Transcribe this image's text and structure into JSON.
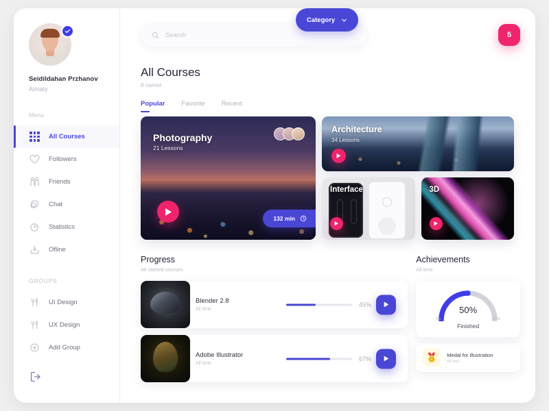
{
  "profile": {
    "name": "Seidildahan Przhanov",
    "city": "Almaty",
    "verified_icon": "check-icon"
  },
  "sidebar": {
    "menu_label": "Menu",
    "groups_label": "GROUPS",
    "menu_items": [
      {
        "label": "All Courses",
        "icon": "grid-icon",
        "active": true
      },
      {
        "label": "Followers",
        "icon": "heart-icon",
        "active": false
      },
      {
        "label": "Friends",
        "icon": "friends-icon",
        "active": false
      },
      {
        "label": "Chat",
        "icon": "chat-icon",
        "active": false
      },
      {
        "label": "Statistics",
        "icon": "pie-chart-icon",
        "active": false
      },
      {
        "label": "Ofline",
        "icon": "download-icon",
        "active": false
      }
    ],
    "groups": [
      {
        "label": "UI Design",
        "icon": "tools-icon"
      },
      {
        "label": "UX Design",
        "icon": "tools-icon"
      },
      {
        "label": "Add Group",
        "icon": "plus-circle-icon"
      }
    ],
    "logout_icon": "logout-icon"
  },
  "topbar": {
    "search_placeholder": "Search",
    "search_value": "",
    "search_icon": "search-icon",
    "category_label": "Category",
    "category_caret_icon": "chevron-down-icon",
    "notification_count": "5"
  },
  "page": {
    "title": "All Courses",
    "subtitle": "8 owned",
    "tabs": [
      {
        "label": "Popular",
        "active": true
      },
      {
        "label": "Favorite",
        "active": false
      },
      {
        "label": "Recent",
        "active": false
      }
    ]
  },
  "courses": {
    "featured": {
      "title": "Photography",
      "lessons": "21 Lessons",
      "duration": "132 min",
      "duration_icon": "clock-icon",
      "play_icon": "play-icon",
      "avatar_count": 3
    },
    "architecture": {
      "title": "Architecture",
      "lessons": "34 Lessons",
      "play_icon": "play-icon"
    },
    "interface": {
      "title": "Interface",
      "play_icon": "play-icon"
    },
    "threed": {
      "title": "3D",
      "play_icon": "play-icon"
    }
  },
  "progress": {
    "title": "Progress",
    "subtitle": "All started courses",
    "items": [
      {
        "name": "Blender 2.8",
        "sub": "All time",
        "percent_label": "45%",
        "percent": 45,
        "play_icon": "play-icon"
      },
      {
        "name": "Adobe Illustrator",
        "sub": "All time",
        "percent_label": "67%",
        "percent": 67,
        "play_icon": "play-icon"
      }
    ]
  },
  "achievements": {
    "title": "Achievements",
    "subtitle": "All time",
    "gauge": {
      "value_label": "50%",
      "value": 50,
      "caption": "Finished",
      "min_label": "0%",
      "max_label": "100%"
    },
    "medals": [
      {
        "name": "Medal for illustration",
        "sub": "All time",
        "icon": "medal-icon"
      }
    ]
  },
  "colors": {
    "accent_blue": "#4a47d6",
    "accent_pink": "#f0246c",
    "background": "#efefef",
    "surface": "#ffffff"
  },
  "chart_data": {
    "type": "gauge",
    "title": "Achievements",
    "values": [
      50
    ],
    "categories": [
      "Finished"
    ],
    "range": [
      0,
      100
    ],
    "value_label": "50%",
    "min_label": "0%",
    "max_label": "100%",
    "arc_color": "#3f3de8",
    "track_color": "#d3d3db"
  }
}
